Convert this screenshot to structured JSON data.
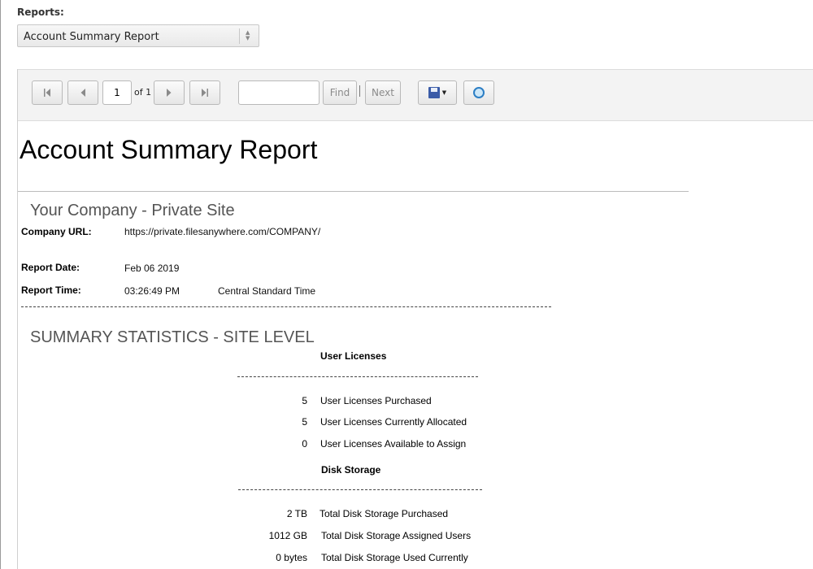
{
  "header": {
    "reports_label": "Reports:",
    "selected_report": "Account Summary Report"
  },
  "toolbar": {
    "page_current": "1",
    "page_of_label": "of 1",
    "find_value": "",
    "find_label": "Find",
    "next_label": "Next"
  },
  "report": {
    "title": "Account Summary Report",
    "site_name": "Your Company - Private Site",
    "company_url_label": "Company URL:",
    "company_url": "https://private.filesanywhere.com/COMPANY/",
    "report_date_label": "Report Date:",
    "report_date": "Feb 06 2019",
    "report_time_label": "Report Time:",
    "report_time": "03:26:49 PM",
    "timezone": "Central Standard Time",
    "summary_title": "SUMMARY STATISTICS - SITE LEVEL",
    "user_licenses": {
      "heading": "User Licenses",
      "rows": [
        {
          "value": "5",
          "label": "User Licenses Purchased"
        },
        {
          "value": "5",
          "label": "User Licenses Currently Allocated"
        },
        {
          "value": "0",
          "label": "User Licenses Available to Assign"
        }
      ]
    },
    "disk_storage": {
      "heading": "Disk Storage",
      "rows": [
        {
          "value": "2 TB",
          "label": "Total Disk Storage Purchased"
        },
        {
          "value": "1012 GB",
          "label": "Total Disk Storage Assigned Users"
        },
        {
          "value": "0 bytes",
          "label": "Total Disk Storage Used Currently"
        }
      ]
    }
  },
  "colors": {
    "toolbar_bg": "#f3f3f3",
    "heading_gray": "#555555",
    "save_icon": "#3b5ca8",
    "refresh_icon": "#2c7ec4"
  },
  "icons": {
    "first_page": "first-page-icon",
    "prev_page": "previous-page-icon",
    "next_page": "next-page-icon",
    "last_page": "last-page-icon",
    "save": "save-icon",
    "refresh": "refresh-icon",
    "select_arrows": "updown-arrows-icon"
  }
}
